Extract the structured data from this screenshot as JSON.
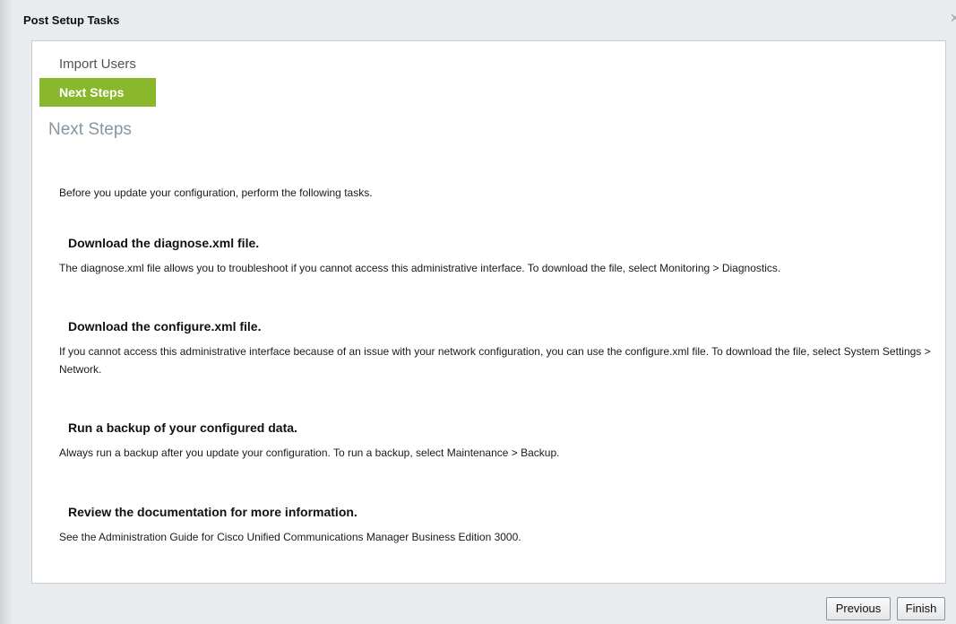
{
  "dialog": {
    "title": "Post Setup Tasks",
    "close_icon": "×"
  },
  "nav": {
    "items": [
      {
        "label": "Import Users",
        "active": false
      },
      {
        "label": "Next Steps",
        "active": true
      }
    ]
  },
  "content": {
    "heading": "Next Steps",
    "intro": "Before you update your configuration, perform the following tasks.",
    "tasks": [
      {
        "title": "Download the diagnose.xml file.",
        "description": "The diagnose.xml file allows you to troubleshoot if you cannot access this administrative interface. To download the file, select Monitoring > Diagnostics."
      },
      {
        "title": "Download the configure.xml file.",
        "description": "If you cannot access this administrative interface because of an issue with your network configuration, you can use the configure.xml file. To download the file, select System Settings > Network."
      },
      {
        "title": "Run a backup of your configured data.",
        "description": "Always run a backup after you update your configuration. To run a backup, select Maintenance > Backup."
      },
      {
        "title": "Review the documentation for more information.",
        "description": "See the Administration Guide for Cisco Unified Communications Manager Business Edition 3000."
      }
    ]
  },
  "footer": {
    "previous_label": "Previous",
    "finish_label": "Finish"
  },
  "colors": {
    "accent": "#8ab82d",
    "heading": "#8797a1"
  }
}
